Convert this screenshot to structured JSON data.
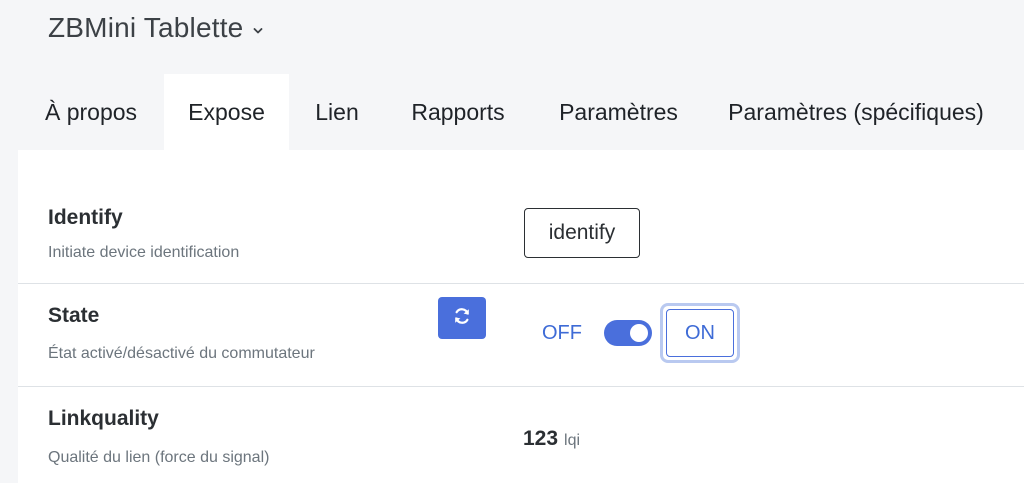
{
  "device": {
    "title": "ZBMini Tablette",
    "dropdown_icon": "chevron-down-icon"
  },
  "tabs": [
    {
      "label": "À propos",
      "active": false
    },
    {
      "label": "Expose",
      "active": true
    },
    {
      "label": "Lien",
      "active": false
    },
    {
      "label": "Rapports",
      "active": false
    },
    {
      "label": "Paramètres",
      "active": false
    },
    {
      "label": "Paramètres (spécifiques)",
      "active": false
    }
  ],
  "features": {
    "identify": {
      "name": "Identify",
      "description": "Initiate device identification",
      "button_label": "identify"
    },
    "state": {
      "name": "State",
      "description": "État activé/désactivé du commutateur",
      "refresh_icon": "refresh-icon",
      "off_label": "OFF",
      "on_label": "ON",
      "toggle_on": true
    },
    "linkquality": {
      "name": "Linkquality",
      "description": "Qualité du lien (force du signal)",
      "value": "123",
      "unit": "lqi"
    }
  },
  "colors": {
    "accent": "#4a6fdc",
    "background": "#f5f6f8",
    "panel": "#ffffff",
    "muted_text": "#6c757d"
  }
}
